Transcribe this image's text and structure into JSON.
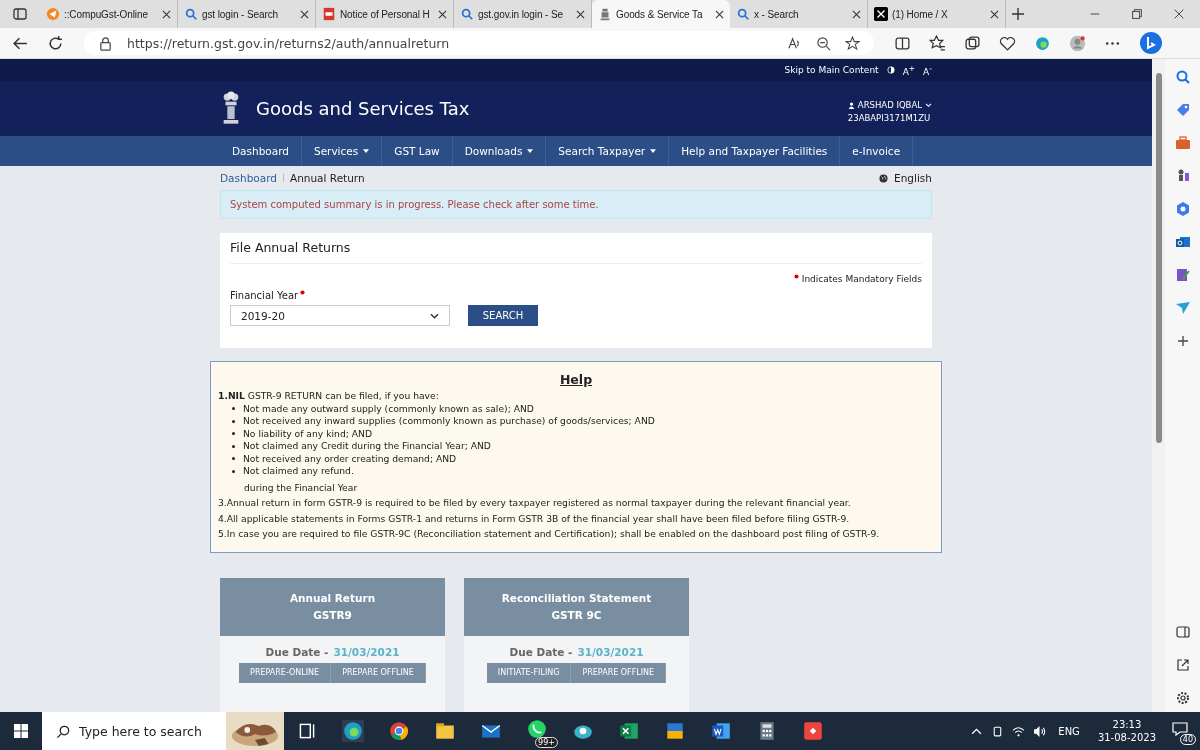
{
  "browser": {
    "tabs": [
      {
        "title": "::CompuGst-Online",
        "selected": false,
        "kind": "app"
      },
      {
        "title": "gst login - Search",
        "selected": false,
        "kind": "search"
      },
      {
        "title": "Notice of Personal H",
        "selected": false,
        "kind": "pdf"
      },
      {
        "title": "gst.gov.in login - Se",
        "selected": false,
        "kind": "search"
      },
      {
        "title": "Goods & Service Ta",
        "selected": true,
        "kind": "emblem"
      },
      {
        "title": "x - Search",
        "selected": false,
        "kind": "search"
      },
      {
        "title": "(1) Home / X",
        "selected": false,
        "kind": "x"
      }
    ],
    "url": "https://return.gst.gov.in/returns2/auth/annualreturn"
  },
  "page": {
    "skip_link": "Skip to Main Content",
    "font_larger": "A$^{+}$",
    "font_smaller": "A$^{-}$",
    "site_title": "Goods and Services Tax",
    "user_name": "ARSHAD IQBAL",
    "gstin": "23ABAPI3171M1ZU",
    "nav": [
      {
        "label": "Dashboard",
        "dropdown": false
      },
      {
        "label": "Services",
        "dropdown": true
      },
      {
        "label": "GST Law",
        "dropdown": false
      },
      {
        "label": "Downloads",
        "dropdown": true
      },
      {
        "label": "Search Taxpayer",
        "dropdown": true
      },
      {
        "label": "Help and Taxpayer Facilities",
        "dropdown": false
      },
      {
        "label": "e-Invoice",
        "dropdown": false
      }
    ],
    "breadcrumb": [
      "Dashboard",
      "Annual Return"
    ],
    "language": "English",
    "alert": "System computed summary is in progress. Please check after some time.",
    "form": {
      "title": "File Annual Returns",
      "mandatory_note": "Indicates Mandatory Fields",
      "field_label": "Financial Year",
      "value": "2019-20",
      "button": "SEARCH"
    },
    "help": {
      "title": "Help",
      "intro": "**1.NIL** GSTR-9 RETURN can be filed, if you have:",
      "bullets": [
        "Not made any outward supply (commonly known as sale); AND",
        "Not received any inward supplies (commonly known as purchase) of goods/services; AND",
        "No liability of any kind; AND",
        "Not claimed any Credit during the Financial Year; AND",
        "Not received any order creating demand; AND",
        "Not claimed any refund."
      ],
      "bullet_note": "during the Financial Year",
      "points": [
        "3.Annual return in form GSTR-9 is required to be filed by every taxpayer registered as normal taxpayer during the relevant financial year.",
        "4.All applicable statements in Forms GSTR-1 and returns in Form GSTR 3B of the financial year shall have been filed before filing GSTR-9.",
        "5.In case you are required to file GSTR-9C (Reconciliation statement and Certification); shall be enabled on the dashboard post filing of GSTR-9."
      ]
    },
    "returns": [
      {
        "title": "Annual Return",
        "code": "GSTR9",
        "due_label": "Due Date -",
        "due_date": "31/03/2021",
        "buttons": [
          "PREPARE-ONLINE",
          "PREPARE OFFLINE"
        ]
      },
      {
        "title": "Reconciliation Statement",
        "code": "GSTR 9C",
        "due_label": "Due Date -",
        "due_date": "31/03/2021",
        "buttons": [
          "INITIATE-FILING",
          "PREPARE OFFLINE"
        ]
      }
    ]
  },
  "taskbar": {
    "search_placeholder": "Type here to search",
    "whatsapp_badge": "99+",
    "language": "ENG",
    "time": "23:13",
    "date": "31-08-2023",
    "notifications": "40"
  }
}
